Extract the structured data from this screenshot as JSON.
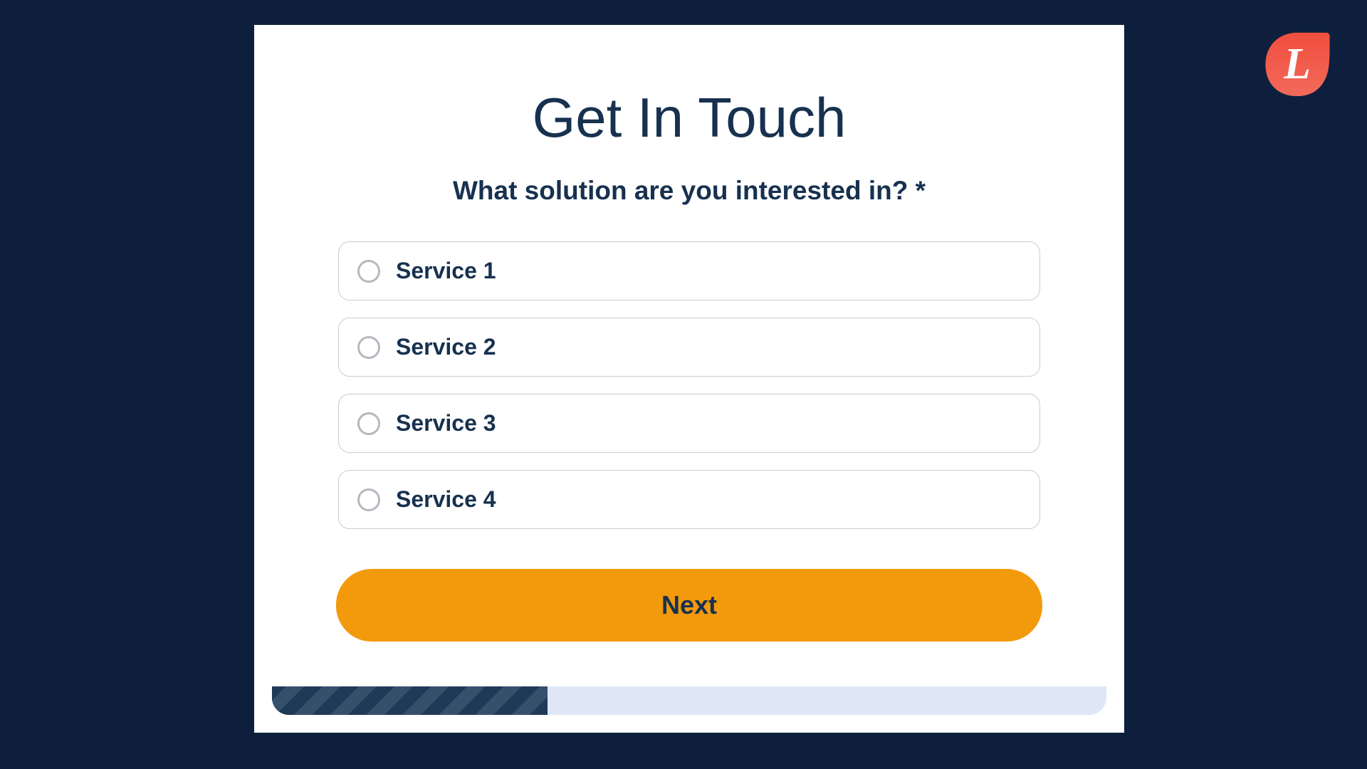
{
  "form": {
    "title": "Get In Touch",
    "question": "What solution are you interested in? *",
    "options": [
      {
        "label": "Service 1"
      },
      {
        "label": "Service 2"
      },
      {
        "label": "Service 3"
      },
      {
        "label": "Service 4"
      }
    ],
    "next_button": "Next"
  },
  "logo": {
    "letter": "L"
  },
  "progress": {
    "percent": 33
  }
}
